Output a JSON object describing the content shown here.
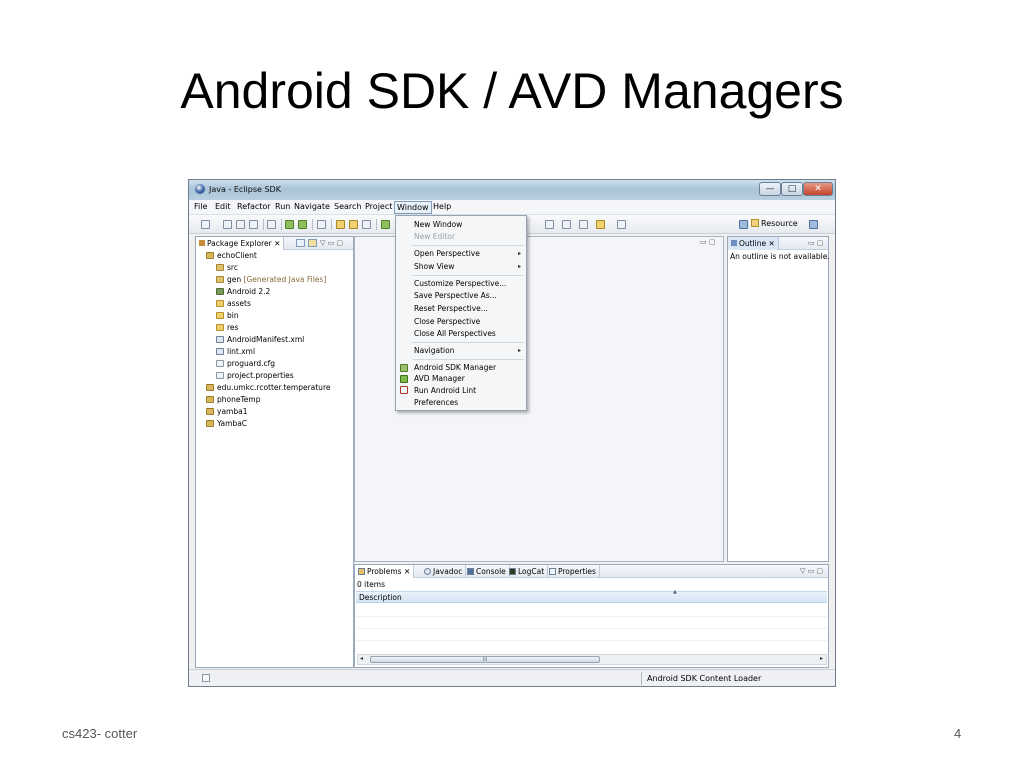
{
  "slide": {
    "title": "Android SDK / AVD Managers",
    "footer": "cs423- cotter",
    "page_number": "4"
  },
  "window": {
    "title": "Java - Eclipse SDK",
    "controls": {
      "minimize": "—",
      "maximize": "□",
      "close": "✕"
    }
  },
  "menubar": [
    "File",
    "Edit",
    "Refactor",
    "Run",
    "Navigate",
    "Search",
    "Project",
    "Window",
    "Help"
  ],
  "toolbar": {
    "perspective_label": "Resource"
  },
  "package_explorer": {
    "tab_label": "Package Explorer",
    "tab_close": "✕",
    "controls": "▽ ▭ ▢",
    "items": [
      {
        "label": "echoClient",
        "icon": "project-icon"
      },
      {
        "label": "src",
        "icon": "source-folder-icon"
      },
      {
        "label": "gen",
        "decoration": "[Generated Java Files]",
        "icon": "source-folder-icon"
      },
      {
        "label": "Android 2.2",
        "icon": "library-icon"
      },
      {
        "label": "assets",
        "icon": "folder-icon"
      },
      {
        "label": "bin",
        "icon": "folder-icon"
      },
      {
        "label": "res",
        "icon": "folder-icon"
      },
      {
        "label": "AndroidManifest.xml",
        "icon": "xml-file-icon"
      },
      {
        "label": "lint.xml",
        "icon": "xml-file-icon"
      },
      {
        "label": "proguard.cfg",
        "icon": "file-icon"
      },
      {
        "label": "project.properties",
        "icon": "file-icon"
      },
      {
        "label": "edu.umkc.rcotter.temperature",
        "icon": "project-icon"
      },
      {
        "label": "phoneTemp",
        "icon": "project-icon"
      },
      {
        "label": "yamba1",
        "icon": "project-icon"
      },
      {
        "label": "YambaC",
        "icon": "project-icon"
      }
    ]
  },
  "outline": {
    "tab_label": "Outline",
    "tab_close": "✕",
    "controls": "▭ ▢",
    "message": "An outline is not available."
  },
  "editor": {
    "controls": "▭ ▢"
  },
  "bottom_panel": {
    "tabs": [
      {
        "label": "Problems",
        "close": "✕",
        "icon": "problems-icon"
      },
      {
        "label": "Javadoc",
        "icon": "javadoc-icon"
      },
      {
        "label": "Console",
        "icon": "console-icon"
      },
      {
        "label": "LogCat",
        "icon": "logcat-icon"
      },
      {
        "label": "Properties",
        "icon": "properties-icon"
      }
    ],
    "controls": "▽ ▭ ▢",
    "item_count": "0 items",
    "column_header": "Description",
    "sort_indicator": "▲",
    "scroll_left": "◂",
    "scroll_right": "▸",
    "scroll_grip": "III"
  },
  "statusbar": {
    "text": "Android SDK Content Loader"
  },
  "window_menu": {
    "items": [
      {
        "label": "New Window",
        "enabled": true
      },
      {
        "label": "New Editor",
        "enabled": false
      },
      {
        "label": "Open Perspective",
        "submenu": true
      },
      {
        "label": "Show View",
        "submenu": true
      },
      {
        "label": "Customize Perspective..."
      },
      {
        "label": "Save Perspective As..."
      },
      {
        "label": "Reset Perspective..."
      },
      {
        "label": "Close Perspective"
      },
      {
        "label": "Close All Perspectives"
      },
      {
        "label": "Navigation",
        "submenu": true
      },
      {
        "label": "Android SDK Manager",
        "icon": "android-sdk-manager-icon"
      },
      {
        "label": "AVD Manager",
        "icon": "avd-manager-icon"
      },
      {
        "label": "Run Android Lint",
        "icon": "android-lint-icon"
      },
      {
        "label": "Preferences"
      }
    ],
    "submenu_arrow": "▸"
  },
  "colors": {
    "menu_active_border": "#7f9db9",
    "selection_blue": "#d4e5f5",
    "window_border": "#6f7d8c"
  }
}
